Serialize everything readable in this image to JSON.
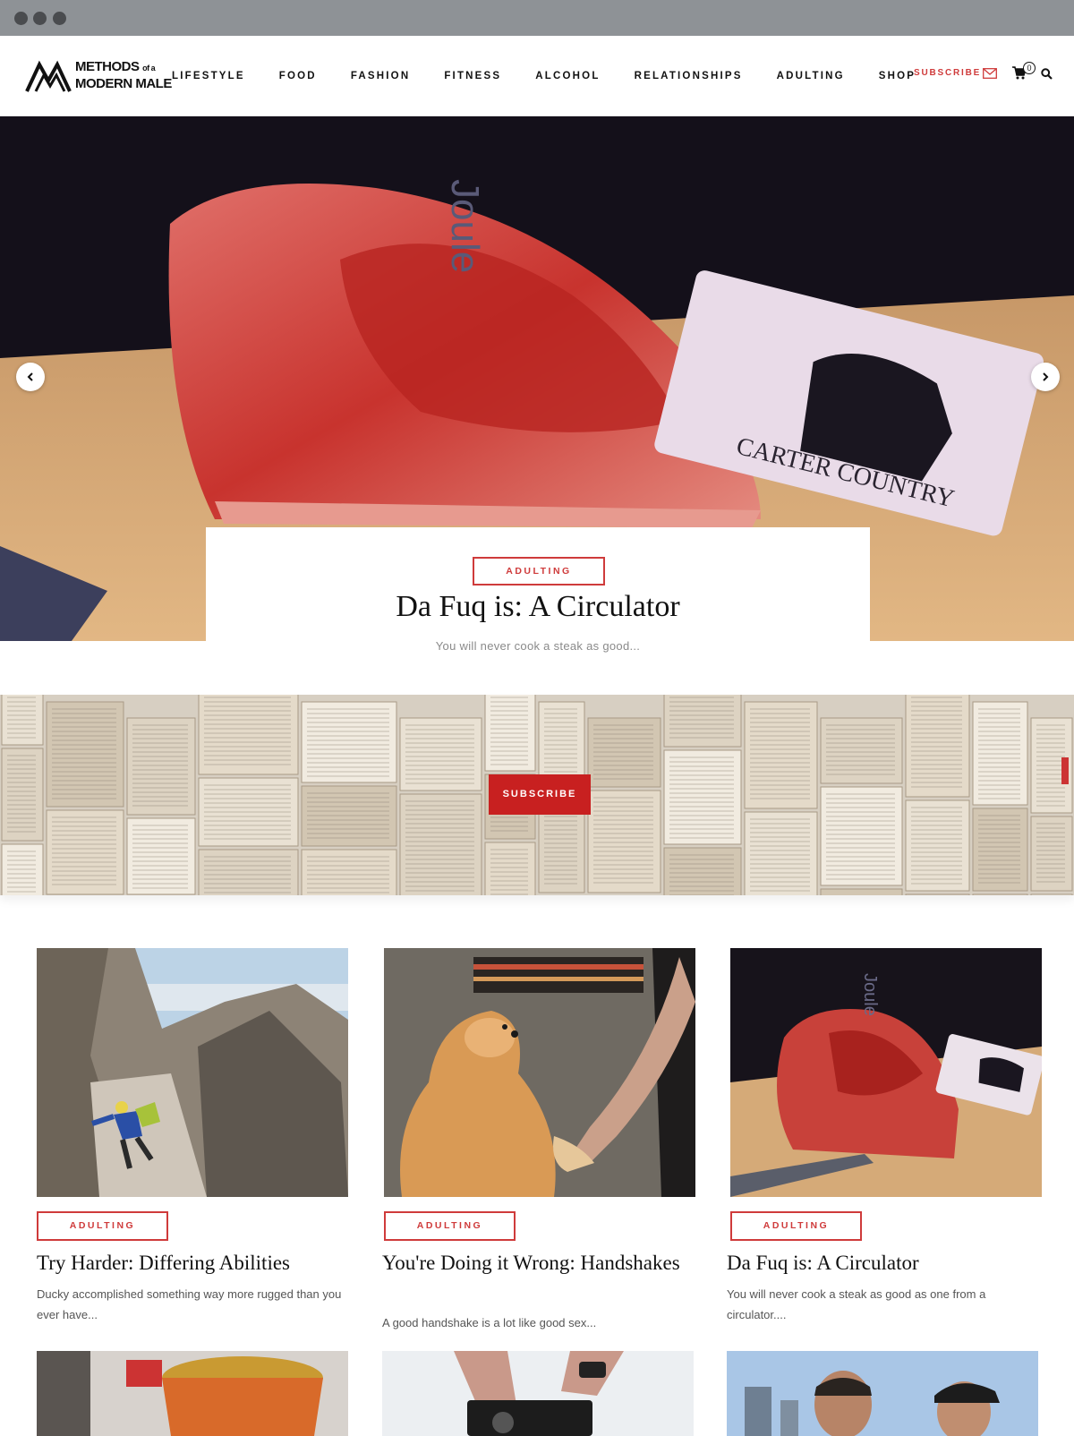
{
  "browser": {
    "dots": [
      "close",
      "minimize",
      "maximize"
    ]
  },
  "header": {
    "logo": {
      "line1": "METHODS",
      "of": "of a",
      "line1b": "A",
      "line2": "MODERN MALE"
    },
    "nav": [
      "LIFESTYLE",
      "FOOD",
      "FASHION",
      "FITNESS",
      "ALCOHOL",
      "RELATIONSHIPS",
      "ADULTING",
      "SHOP"
    ],
    "subscribe_label": "SUBSCRIBE",
    "cart_count": "0"
  },
  "hero": {
    "tag": "ADULTING",
    "title": "Da Fuq is: A Circulator",
    "excerpt": "You will never cook a steak as good..."
  },
  "banner": {
    "button_label": "SUBSCRIBE"
  },
  "posts": [
    {
      "tag": "ADULTING",
      "title": "Try Harder: Differing Abilities",
      "excerpt": "Ducky accomplished something way more rugged than you ever have..."
    },
    {
      "tag": "ADULTING",
      "title": "You're Doing it Wrong: Handshakes",
      "excerpt": "A good handshake is a lot like good sex..."
    },
    {
      "tag": "ADULTING",
      "title": "Da Fuq is: A Circulator",
      "excerpt": "You will never cook a steak as good as one from a circulator...."
    }
  ],
  "colors": {
    "accent": "#cf3b3b",
    "button": "#c82020",
    "chrome": "#8e9296"
  }
}
